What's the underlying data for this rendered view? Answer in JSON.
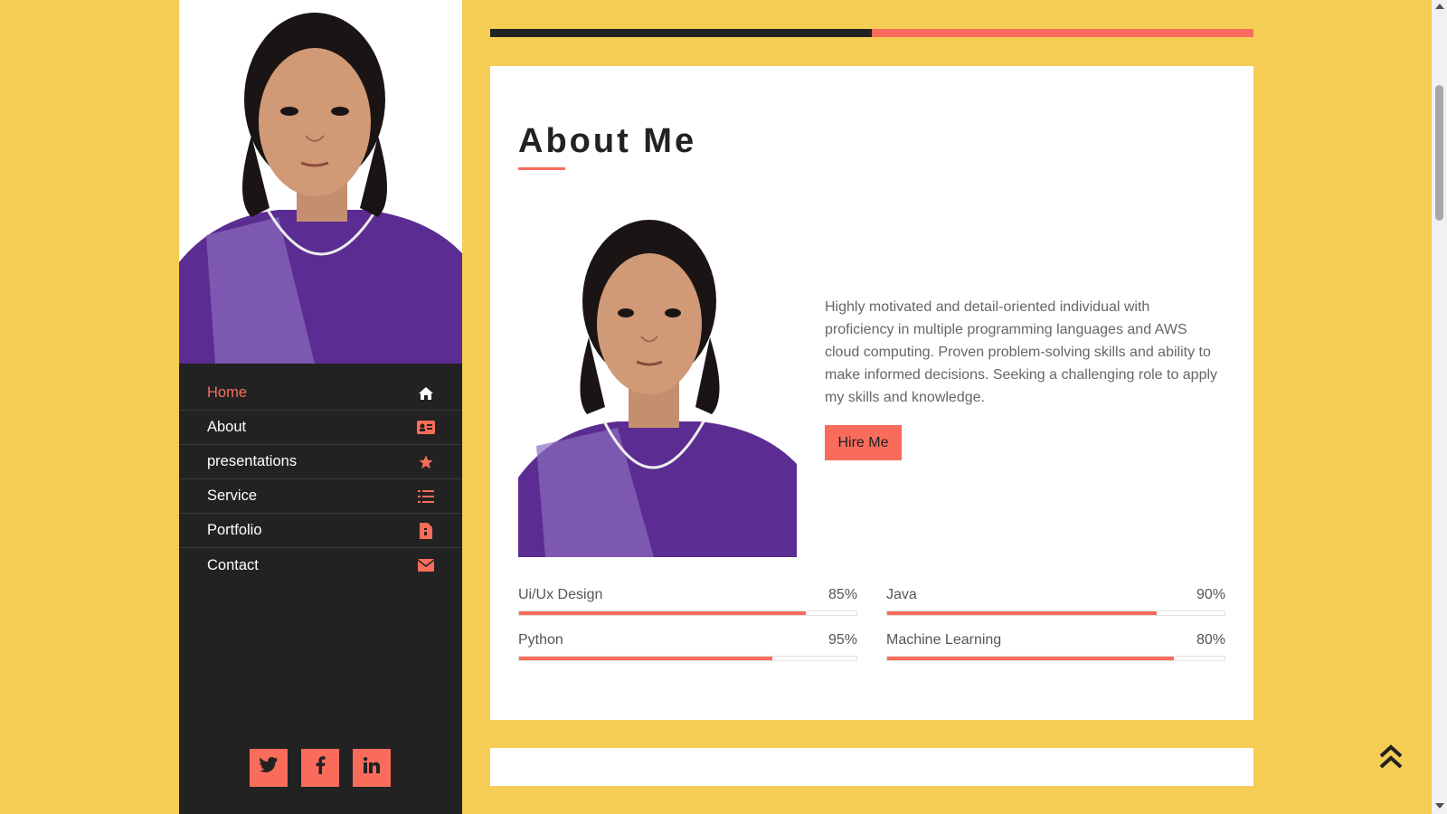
{
  "colors": {
    "background": "#f5cd55",
    "sidebar": "#222222",
    "accent": "#f96c5b",
    "card": "#ffffff"
  },
  "sidebar": {
    "photo_icon": "portrait-photo",
    "nav": [
      {
        "label": "Home",
        "icon": "home-icon",
        "active": true
      },
      {
        "label": "About",
        "icon": "id-card-icon",
        "active": false
      },
      {
        "label": "presentations",
        "icon": "star-icon",
        "active": false
      },
      {
        "label": "Service",
        "icon": "list-check-icon",
        "active": false
      },
      {
        "label": "Portfolio",
        "icon": "file-icon",
        "active": false
      },
      {
        "label": "Contact",
        "icon": "envelope-icon",
        "active": false
      }
    ],
    "social": [
      {
        "icon": "twitter-icon"
      },
      {
        "icon": "facebook-icon"
      },
      {
        "icon": "linkedin-icon"
      }
    ]
  },
  "page_progress": 0.5,
  "about": {
    "title": "About Me",
    "description": "Highly motivated and detail-oriented individual with proficiency in multiple programming languages and AWS cloud computing. Proven problem-solving skills and ability to make informed decisions. Seeking a challenging role to apply my skills and knowledge.",
    "hire_label": "Hire Me",
    "skills": [
      {
        "name": "Ui/Ux Design",
        "percent_label": "85%",
        "fill": 0.85
      },
      {
        "name": "Java",
        "percent_label": "90%",
        "fill": 0.8
      },
      {
        "name": "Python",
        "percent_label": "95%",
        "fill": 0.75
      },
      {
        "name": "Machine Learning",
        "percent_label": "80%",
        "fill": 0.85
      }
    ]
  },
  "back_to_top_icon": "double-chevron-up-icon"
}
